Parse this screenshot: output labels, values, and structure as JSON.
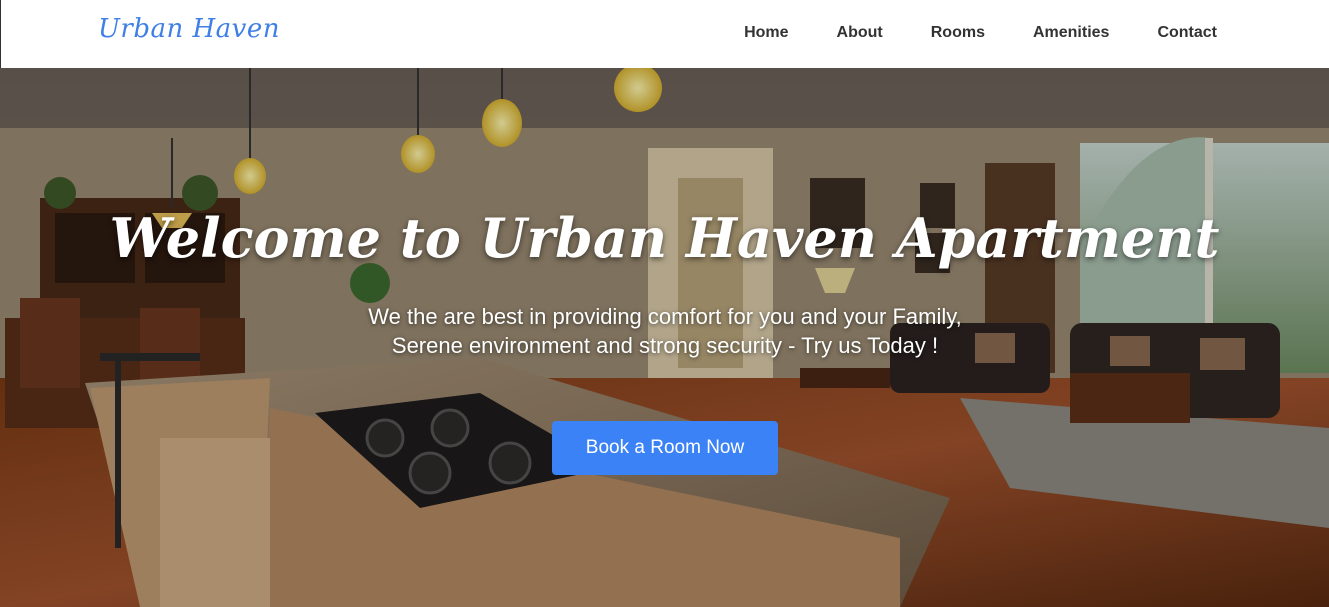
{
  "navbar": {
    "brand": "Urban Haven",
    "links": [
      "Home",
      "About",
      "Rooms",
      "Amenities",
      "Contact"
    ]
  },
  "hero": {
    "title": "Welcome to Urban Haven Apartment",
    "subtitle": "We the are best in providing comfort for you and your Family, Serene environment and strong security - Try us Today !",
    "cta_label": "Book a Room Now",
    "background_image": "apartment-interior-photo"
  },
  "colors": {
    "brand": "#3f7fe6",
    "nav_text": "#333333",
    "cta_bg": "#3b82f6",
    "hero_text": "#ffffff"
  }
}
